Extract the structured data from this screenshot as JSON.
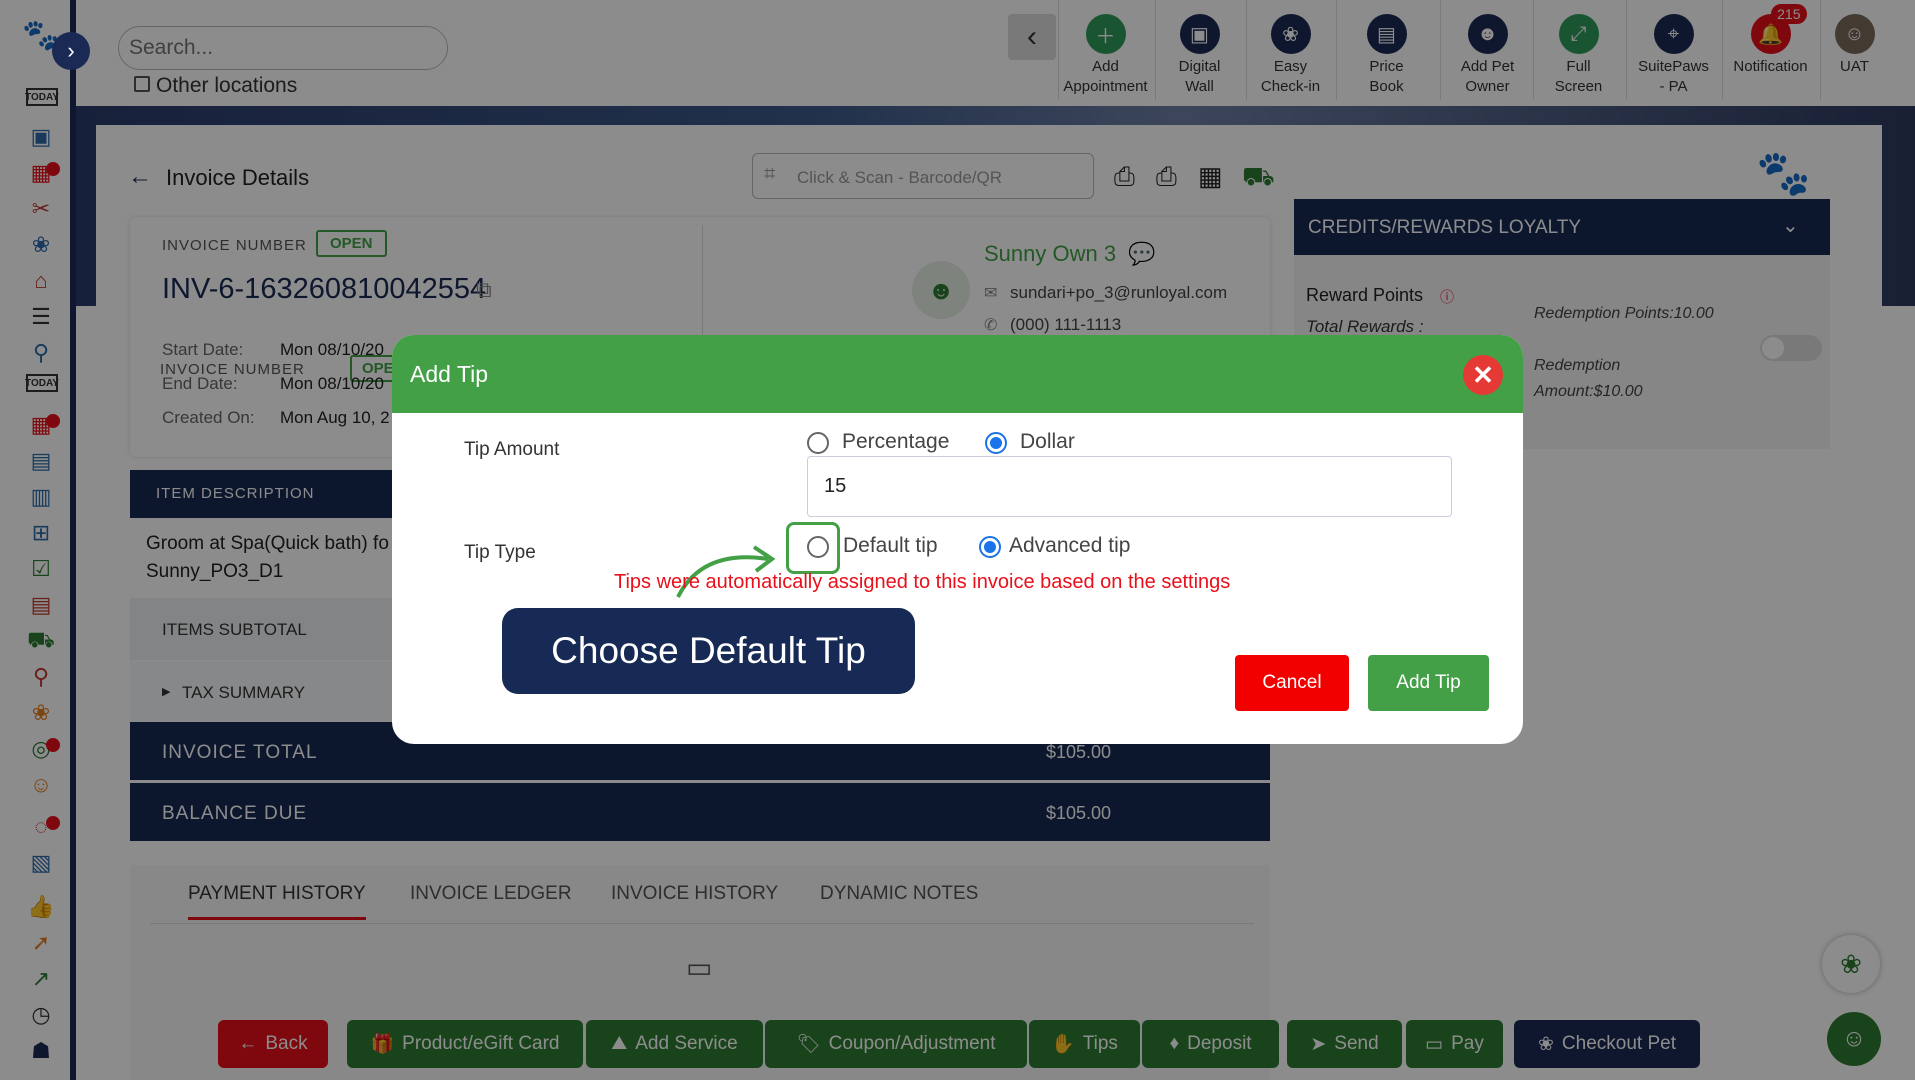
{
  "topbar": {
    "search_placeholder": "Search...",
    "other_locations": "Other locations",
    "buttons": [
      {
        "label": "Add\nAppointment",
        "icon": "calendar-plus-icon"
      },
      {
        "label": "Digital\nWall",
        "icon": "monitor-icon"
      },
      {
        "label": "Easy\nCheck-in",
        "icon": "paw-icon"
      },
      {
        "label": "Price\nBook",
        "icon": "book-icon"
      },
      {
        "label": "Add Pet\nOwner",
        "icon": "user-plus-icon"
      },
      {
        "label": "Full\nScreen",
        "icon": "expand-icon"
      },
      {
        "label": "SuitePaws\n- PA",
        "icon": "location-icon"
      },
      {
        "label": "Notification",
        "icon": "bell-icon",
        "badge": "215"
      },
      {
        "label": "UAT",
        "icon": "avatar"
      }
    ]
  },
  "invoice": {
    "page_title": "Invoice Details",
    "scan_placeholder": "Click & Scan - Barcode/QR",
    "number_label": "INVOICE NUMBER",
    "status": "OPEN",
    "number": "INV-6-163260810042554",
    "start_label": "Start Date:",
    "start_value": "Mon 08/10/20",
    "end_label": "End Date:",
    "end_value": "Mon 08/10/20",
    "created_label": "Created On:",
    "created_value": "Mon Aug 10, 2",
    "owner_name": "Sunny Own 3",
    "owner_email": "sundari+po_3@runloyal.com",
    "owner_phone": "(000) 111-1113",
    "item_header": "ITEM DESCRIPTION",
    "item_line1": "Groom at Spa(Quick bath) fo",
    "item_line2": "Sunny_PO3_D1",
    "subtotal_label": "ITEMS SUBTOTAL",
    "tax_label": "TAX SUMMARY",
    "total_label": "INVOICE TOTAL",
    "total_value": "$105.00",
    "balance_label": "BALANCE DUE",
    "balance_value": "$105.00"
  },
  "tabs": [
    "PAYMENT HISTORY",
    "INVOICE LEDGER",
    "INVOICE HISTORY",
    "DYNAMIC NOTES"
  ],
  "loyalty": {
    "title": "CREDITS/REWARDS LOYALTY",
    "reward_points": "Reward Points",
    "total_rewards": "Total Rewards :",
    "redemption_points": "Redemption Points:10.00",
    "redemption_amount": "Redemption Amount:$10.00"
  },
  "modal": {
    "title": "Add Tip",
    "tip_amount_label": "Tip Amount",
    "percentage": "Percentage",
    "dollar": "Dollar",
    "amount_value": "15",
    "tip_type_label": "Tip Type",
    "default_tip": "Default tip",
    "advanced_tip": "Advanced tip",
    "notice": "Tips were automatically assigned to this invoice based on the settings",
    "callout": "Choose Default Tip",
    "cancel": "Cancel",
    "add_tip": "Add Tip"
  },
  "bottombar": {
    "back": "Back",
    "product": "Product/eGift Card",
    "add_service": "Add Service",
    "coupon": "Coupon/Adjustment",
    "tips": "Tips",
    "deposit": "Deposit",
    "send": "Send",
    "pay": "Pay",
    "checkout": "Checkout Pet"
  },
  "colors": {
    "navy": "#172a55",
    "green": "#43a047",
    "red": "#e8101a",
    "accent": "#1a73e8"
  }
}
